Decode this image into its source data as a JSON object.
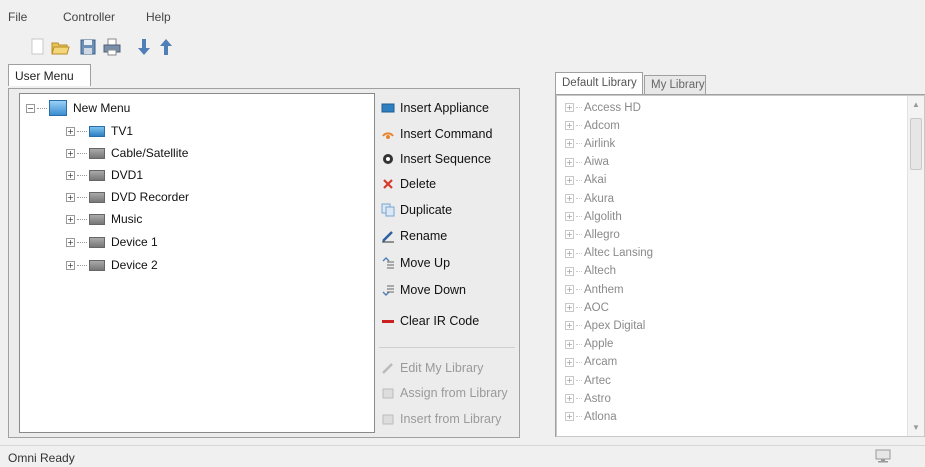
{
  "menu": [
    "File",
    "Controller",
    "Help"
  ],
  "toolbar": {
    "icons": [
      "new-document-icon",
      "open-folder-icon",
      "save-icon",
      "print-icon",
      "download-arrow-icon",
      "upload-arrow-icon"
    ]
  },
  "left_tabs": {
    "user_menu": "User Menu"
  },
  "tree": {
    "root": "New Menu",
    "items": [
      "TV1",
      "Cable/Satellite",
      "DVD1",
      "DVD Recorder",
      "Music",
      "Device 1",
      "Device 2"
    ]
  },
  "actions": {
    "insert_appliance": "Insert Appliance",
    "insert_command": "Insert Command",
    "insert_sequence": "Insert Sequence",
    "delete": "Delete",
    "duplicate": "Duplicate",
    "rename": "Rename",
    "move_up": "Move Up",
    "move_down": "Move Down",
    "clear_ir": "Clear IR Code",
    "edit_library": "Edit My Library",
    "assign_library": "Assign from Library",
    "insert_library": "Insert from Library"
  },
  "right_tabs": {
    "default_library": "Default Library",
    "my_library": "My Library"
  },
  "library": [
    "Access HD",
    "Adcom",
    "Airlink",
    "Aiwa",
    "Akai",
    "Akura",
    "Algolith",
    "Allegro",
    "Altec Lansing",
    "Altech",
    "Anthem",
    "AOC",
    "Apex Digital",
    "Apple",
    "Arcam",
    "Artec",
    "Astro",
    "Atlona"
  ],
  "status": {
    "text": "Omni Ready"
  },
  "colors": {
    "delete_red": "#d63a2a",
    "clear_ir_red": "#cc1f1f",
    "appliance_blue": "#2d7fc1",
    "command_orange": "#e8842c"
  }
}
